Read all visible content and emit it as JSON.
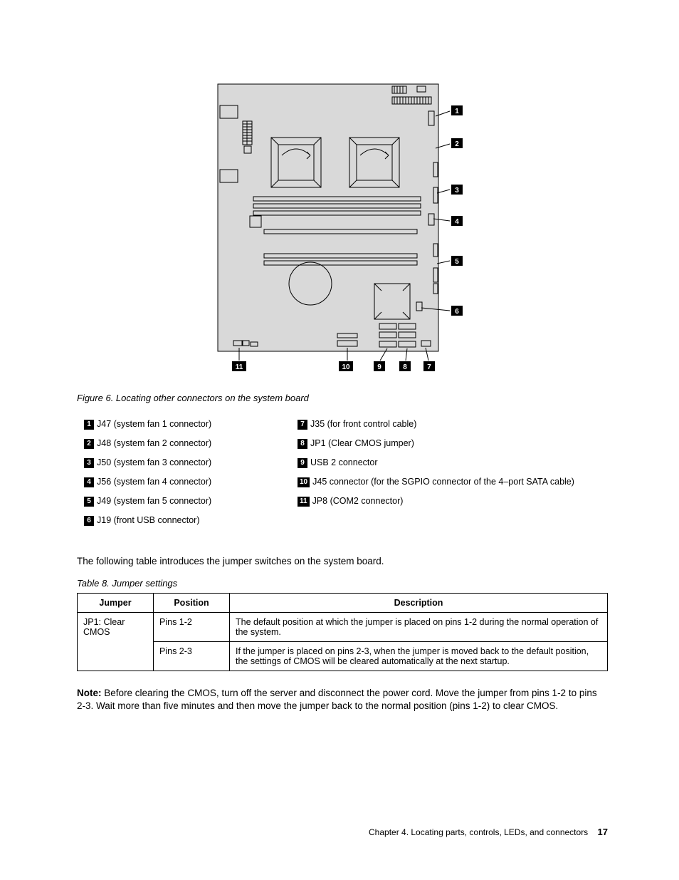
{
  "figure": {
    "caption": "Figure 6.  Locating other connectors on the system board"
  },
  "callouts": {
    "right": [
      "1",
      "2",
      "3",
      "4",
      "5",
      "6"
    ],
    "bottom": [
      "11",
      "10",
      "9",
      "8",
      "7"
    ]
  },
  "legend": {
    "left": [
      {
        "n": "1",
        "t": "J47 (system fan 1 connector)"
      },
      {
        "n": "2",
        "t": "J48 (system fan 2 connector)"
      },
      {
        "n": "3",
        "t": "J50 (system fan 3 connector)"
      },
      {
        "n": "4",
        "t": "J56 (system fan 4 connector)"
      },
      {
        "n": "5",
        "t": "J49 (system fan 5 connector)"
      },
      {
        "n": "6",
        "t": "J19 (front USB connector)"
      }
    ],
    "right": [
      {
        "n": "7",
        "t": "J35 (for front control cable)"
      },
      {
        "n": "8",
        "t": "JP1 (Clear CMOS jumper)"
      },
      {
        "n": "9",
        "t": "USB 2 connector"
      },
      {
        "n": "10",
        "t": "J45 connector (for the SGPIO connector of the 4–port SATA cable)"
      },
      {
        "n": "11",
        "t": "JP8 (COM2 connector)"
      }
    ]
  },
  "intro": "The following table introduces the jumper switches on the system board.",
  "table": {
    "caption": "Table 8.  Jumper settings",
    "head": [
      "Jumper",
      "Position",
      "Description"
    ],
    "rows": [
      {
        "c0": "JP1: Clear CMOS",
        "c1": "Pins 1-2",
        "c2": "The default position at which the jumper is placed on pins 1-2 during the normal operation of the system."
      },
      {
        "c0": "",
        "c1": "Pins 2-3",
        "c2": "If the jumper is placed on pins 2-3, when the jumper is moved back to the default position, the settings of CMOS will be cleared automatically at the next startup."
      }
    ]
  },
  "note": {
    "label": "Note:",
    "text": " Before clearing the CMOS, turn off the server and disconnect the power cord.  Move the jumper from pins 1-2 to pins 2-3.  Wait more than five minutes and then move the jumper back to the normal position (pins 1-2) to clear CMOS."
  },
  "footer": {
    "chapter": "Chapter 4.  Locating parts, controls, LEDs, and connectors",
    "page": "17"
  }
}
